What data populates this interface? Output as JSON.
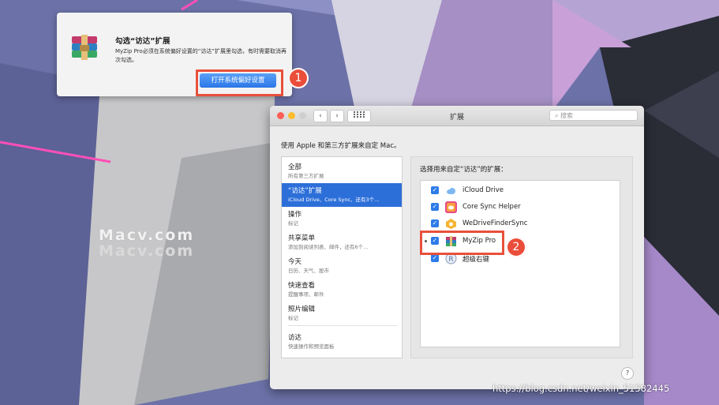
{
  "watermark": {
    "line1": "Macv.com",
    "line2": "Macv.com"
  },
  "notification": {
    "title": "勾选“访达”扩展",
    "body": "MyZip Pro必须在系统偏好设置的“访达”扩展里勾选，有时需要取消再次勾选。",
    "button_label": "打开系统偏好设置",
    "icon": "winrar-archive-icon",
    "step_badge": "1"
  },
  "window": {
    "title": "扩展",
    "search_placeholder": "搜索",
    "description": "使用 Apple 和第三方扩展来自定 Mac。",
    "grid_icon": "grid-icon",
    "help_label": "?",
    "colors": {
      "close": "#fc5f57",
      "minimize": "#fdbc2e",
      "zoom": "#cfcfcf",
      "selected": "#2d6fd9",
      "accent": "#2e7be8"
    }
  },
  "sidebar": {
    "items": [
      {
        "title": "全部",
        "subtitle": "所有第三方扩展"
      },
      {
        "title": "“访达”扩展",
        "subtitle": "iCloud Drive、Core Sync、还有3个...",
        "selected": true
      },
      {
        "title": "操作",
        "subtitle": "标记"
      },
      {
        "title": "共享菜单",
        "subtitle": "添加到阅读列表、邮件，还有6个..."
      },
      {
        "title": "今天",
        "subtitle": "日历、天气、股市"
      },
      {
        "title": "快速查看",
        "subtitle": "提醒事项、邮件"
      },
      {
        "title": "照片编辑",
        "subtitle": "标记"
      },
      {
        "title": "访达",
        "subtitle": "快速操作和预览面板"
      }
    ]
  },
  "extensions": {
    "label": "选择用来自定“访达”的扩展：",
    "items": [
      {
        "name": "iCloud Drive",
        "checked": true,
        "icon": "icloud-icon"
      },
      {
        "name": "Core Sync Helper",
        "checked": true,
        "icon": "creative-cloud-icon"
      },
      {
        "name": "WeDriveFinderSync",
        "checked": true,
        "icon": "wedrive-icon"
      },
      {
        "name": "MyZip Pro",
        "checked": true,
        "icon": "myzip-icon"
      },
      {
        "name": "超级右键",
        "checked": true,
        "icon": "super-right-click-icon"
      }
    ],
    "step_badge": "2"
  },
  "footer_watermark": "https://blog.csdn.net/weixin_51582445"
}
